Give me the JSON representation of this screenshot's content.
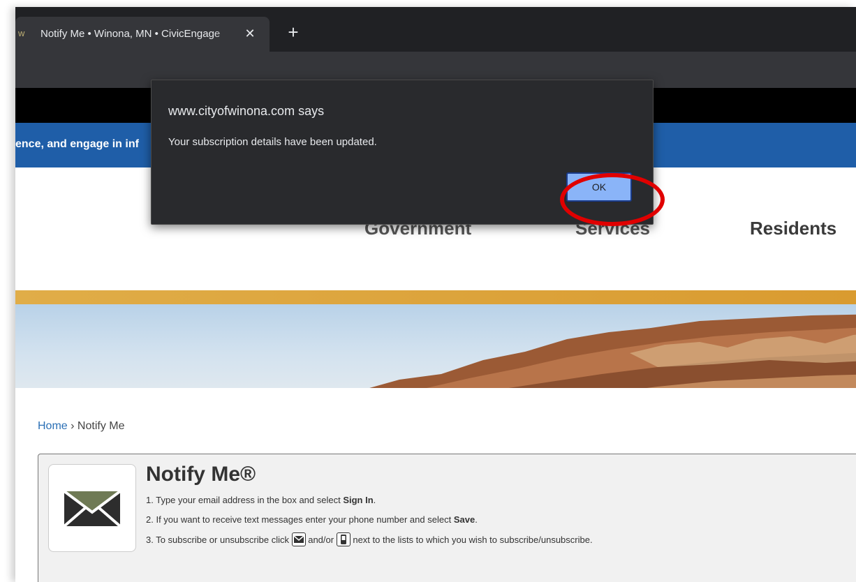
{
  "browser": {
    "tab_title": "Notify Me • Winona, MN • CivicEngage",
    "tab_close": "✕",
    "new_tab": "+"
  },
  "site": {
    "ticker_text": "ence, and engage in inf",
    "nav": [
      "Government",
      "Services",
      "Residents"
    ]
  },
  "dialog": {
    "title": "www.cityofwinona.com says",
    "message": "Your subscription details have been updated.",
    "ok_label": "OK"
  },
  "breadcrumb": {
    "home": "Home",
    "sep": "›",
    "current": "Notify Me"
  },
  "notify": {
    "title": "Notify Me®",
    "step1_a": "1. Type your email address in the box and select ",
    "step1_b": "Sign In",
    "step1_c": ".",
    "step2_a": "2. If you want to receive text messages enter your phone number and select ",
    "step2_b": "Save",
    "step2_c": ".",
    "step3_a": "3. To subscribe or unsubscribe click",
    "step3_b": "and/or",
    "step3_c": "next to the lists to which you wish to subscribe/unsubscribe."
  },
  "colors": {
    "highlight": "#e00000",
    "ok_button": "#8ab4f8",
    "site_blue": "#1f5ea8"
  }
}
